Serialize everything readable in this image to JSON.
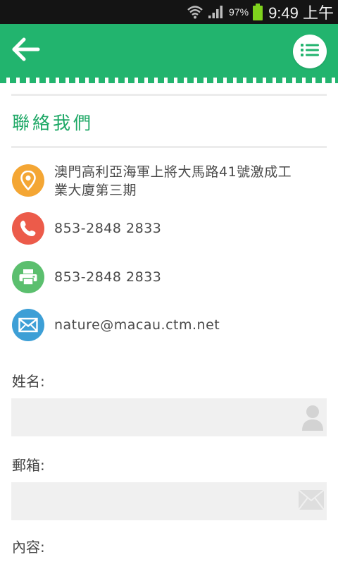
{
  "status_bar": {
    "battery_percent": "97%",
    "time": "9:49 上午",
    "icons": [
      "wifi-icon",
      "signal-icon",
      "battery-icon"
    ]
  },
  "app_bar": {
    "color": "#22b46e",
    "back_icon": "back-arrow-icon",
    "menu_icon": "list-icon"
  },
  "contact": {
    "title": "聯絡我們",
    "items": [
      {
        "icon": "location-pin-icon",
        "color": "#f4a634",
        "text_line1": "澳門高利亞海軍上將大馬路41號激成工",
        "text_line2": "業大廈第三期"
      },
      {
        "icon": "phone-icon",
        "color": "#ec5b4a",
        "text": "853-2848 2833"
      },
      {
        "icon": "fax-printer-icon",
        "color": "#5bbf6e",
        "text": "853-2848 2833"
      },
      {
        "icon": "email-icon",
        "color": "#3d9fd6",
        "text": "nature@macau.ctm.net"
      }
    ]
  },
  "form": {
    "name_label": "姓名:",
    "name_value": "",
    "name_icon": "user-icon",
    "email_label": "郵箱:",
    "email_value": "",
    "email_icon": "envelope-icon",
    "content_label": "內容:"
  }
}
